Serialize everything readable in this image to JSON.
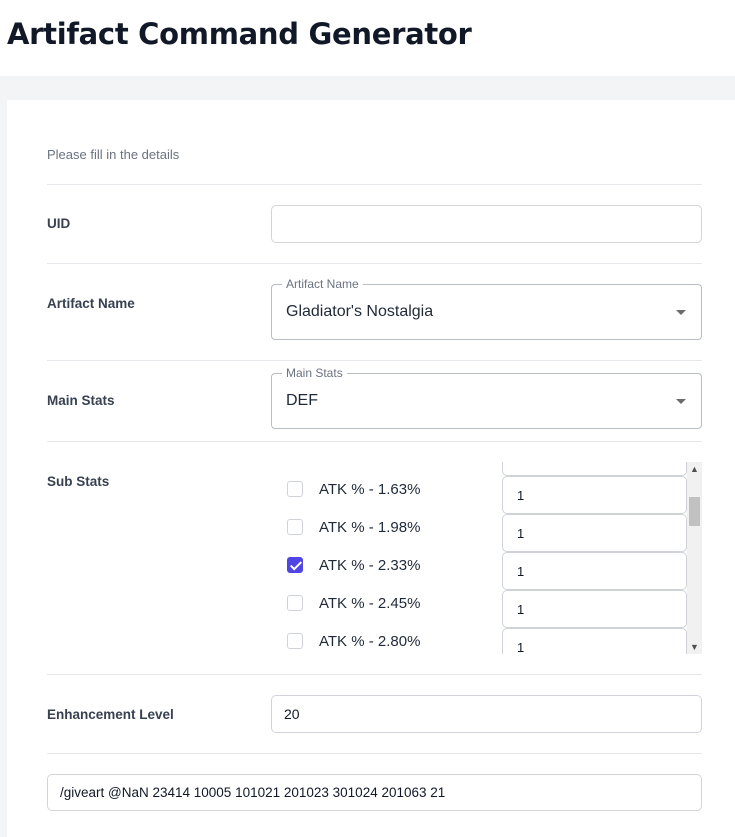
{
  "header": {
    "title": "Artifact Command Generator"
  },
  "form": {
    "subtitle": "Please fill in the details",
    "uid": {
      "label": "UID",
      "value": "",
      "placeholder": ""
    },
    "artifact_name": {
      "label": "Artifact Name",
      "legend": "Artifact Name",
      "value": "Gladiator's Nostalgia"
    },
    "main_stats": {
      "label": "Main Stats",
      "legend": "Main Stats",
      "value": "DEF"
    },
    "sub_stats": {
      "label": "Sub Stats",
      "items": [
        {
          "label": "ATK % - 1.63%",
          "checked": false,
          "quantity": "1"
        },
        {
          "label": "ATK % - 1.98%",
          "checked": false,
          "quantity": "1"
        },
        {
          "label": "ATK % - 2.33%",
          "checked": true,
          "quantity": "1"
        },
        {
          "label": "ATK % - 2.45%",
          "checked": false,
          "quantity": "1"
        },
        {
          "label": "ATK % - 2.80%",
          "checked": false,
          "quantity": "1"
        }
      ],
      "scroll_fraction": 0.17
    },
    "enhancement_level": {
      "label": "Enhancement Level",
      "value": "20"
    },
    "command": {
      "value": "/giveart @NaN 23414 10005 101021 201023 301024 201063 21"
    }
  },
  "colors": {
    "accent": "#4f46e5",
    "background": "#f3f4f6",
    "border": "#d1d5db"
  },
  "icons": {
    "select_caret": "caret-down-icon",
    "scroll_up": "scroll-up-icon",
    "scroll_down": "scroll-down-icon",
    "check": "check-icon"
  }
}
